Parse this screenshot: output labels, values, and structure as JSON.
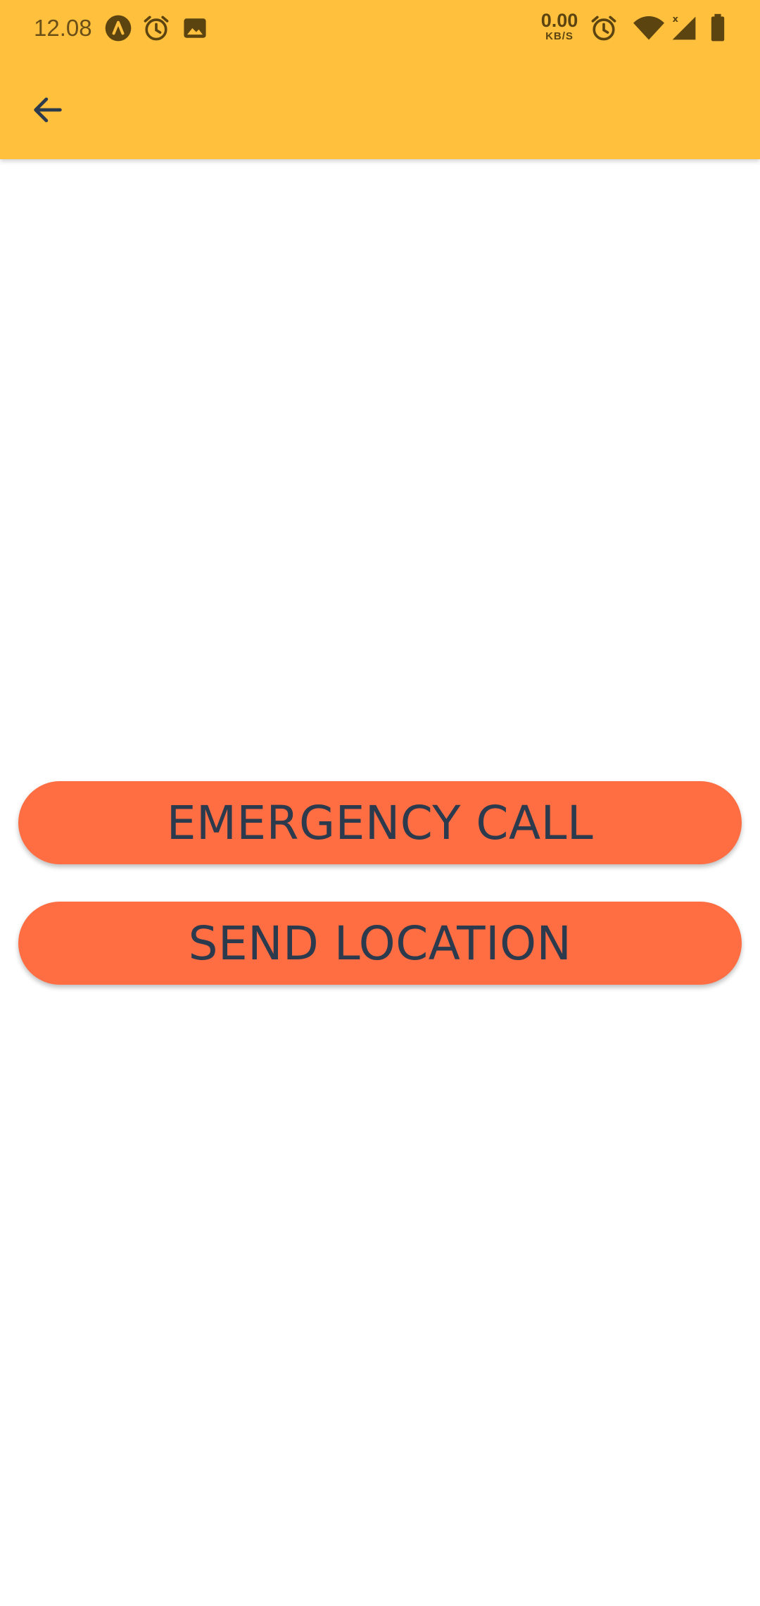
{
  "status_bar": {
    "time": "12.08",
    "net_speed_value": "0.00",
    "net_speed_unit": "KB/S",
    "icons": [
      "app-a-icon",
      "alarm-icon",
      "image-icon",
      "alarm-icon",
      "wifi-icon",
      "signal-icon",
      "battery-icon"
    ]
  },
  "app_bar": {
    "back_icon": "arrow-back-icon"
  },
  "actions": {
    "emergency_call_label": "EMERGENCY CALL",
    "send_location_label": "SEND LOCATION"
  },
  "colors": {
    "header": "#FFC03D",
    "button": "#FF6D42",
    "button_text": "#2C3A4E",
    "status_text": "#6a5018"
  }
}
